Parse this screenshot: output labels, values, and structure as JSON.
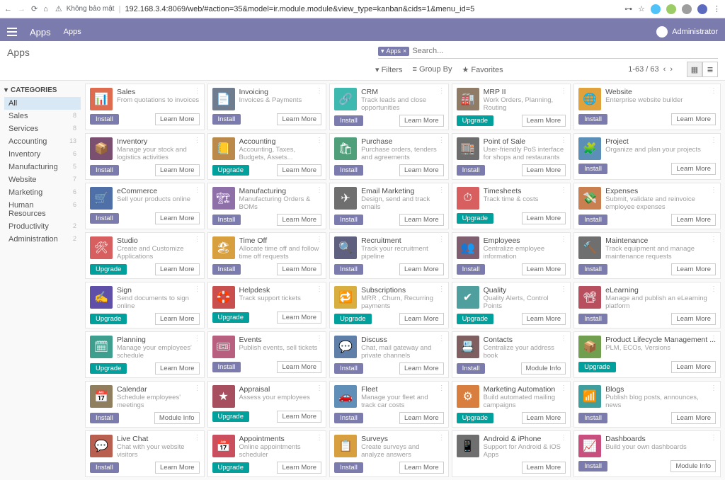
{
  "chrome": {
    "insecure": "Không bảo mật",
    "url": "192.168.3.4:8069/web/#action=35&model=ir.module.module&view_type=kanban&cids=1&menu_id=5"
  },
  "topbar": {
    "brand": "Apps",
    "menu": "Apps",
    "user": "Administrator"
  },
  "cp": {
    "title": "Apps",
    "facet_label": "Apps",
    "search_placeholder": "Search...",
    "filters": "Filters",
    "groupby": "Group By",
    "favorites": "Favorites",
    "pager": "1-63 / 63"
  },
  "sidebar": {
    "heading": "CATEGORIES",
    "items": [
      {
        "label": "All",
        "count": "",
        "active": true
      },
      {
        "label": "Sales",
        "count": "8"
      },
      {
        "label": "Services",
        "count": "8"
      },
      {
        "label": "Accounting",
        "count": "13"
      },
      {
        "label": "Inventory",
        "count": "6"
      },
      {
        "label": "Manufacturing",
        "count": "5"
      },
      {
        "label": "Website",
        "count": "7"
      },
      {
        "label": "Marketing",
        "count": "6"
      },
      {
        "label": "Human Resources",
        "count": "6"
      },
      {
        "label": "Productivity",
        "count": "2"
      },
      {
        "label": "Administration",
        "count": "2"
      }
    ]
  },
  "btn_labels": {
    "install": "Install",
    "upgrade": "Upgrade",
    "learn": "Learn More",
    "moduleinfo": "Module Info"
  },
  "apps": [
    {
      "name": "Sales",
      "desc": "From quotations to invoices",
      "color": "#e06c50",
      "btn": "install",
      "lm": "learn"
    },
    {
      "name": "Invoicing",
      "desc": "Invoices & Payments",
      "color": "#707d8f",
      "btn": "install",
      "lm": "learn"
    },
    {
      "name": "CRM",
      "desc": "Track leads and close opportunities",
      "color": "#3db9af",
      "btn": "install",
      "lm": "learn"
    },
    {
      "name": "MRP II",
      "desc": "Work Orders, Planning, Routing",
      "color": "#8f7b66",
      "btn": "upgrade",
      "lm": "learn"
    },
    {
      "name": "Website",
      "desc": "Enterprise website builder",
      "color": "#e2a23b",
      "btn": "install",
      "lm": "learn"
    },
    {
      "name": "Inventory",
      "desc": "Manage your stock and logistics activities",
      "color": "#7a4f6f",
      "btn": "install",
      "lm": "learn"
    },
    {
      "name": "Accounting",
      "desc": "Accounting, Taxes, Budgets, Assets...",
      "color": "#bb8a4a",
      "btn": "upgrade",
      "lm": "learn"
    },
    {
      "name": "Purchase",
      "desc": "Purchase orders, tenders and agreements",
      "color": "#4f9f7a",
      "btn": "install",
      "lm": "learn"
    },
    {
      "name": "Point of Sale",
      "desc": "User-friendly PoS interface for shops and restaurants",
      "color": "#6d6d6d",
      "btn": "install",
      "lm": "learn"
    },
    {
      "name": "Project",
      "desc": "Organize and plan your projects",
      "color": "#5c8fb8",
      "btn": "install",
      "lm": "learn"
    },
    {
      "name": "eCommerce",
      "desc": "Sell your products online",
      "color": "#4f6fa8",
      "btn": "install",
      "lm": "learn"
    },
    {
      "name": "Manufacturing",
      "desc": "Manufacturing Orders & BOMs",
      "color": "#8f6fa8",
      "btn": "install",
      "lm": "learn"
    },
    {
      "name": "Email Marketing",
      "desc": "Design, send and track emails",
      "color": "#6f6f6f",
      "btn": "install",
      "lm": "learn"
    },
    {
      "name": "Timesheets",
      "desc": "Track time & costs",
      "color": "#d85f5f",
      "btn": "upgrade",
      "lm": "learn"
    },
    {
      "name": "Expenses",
      "desc": "Submit, validate and reinvoice employee expenses",
      "color": "#c97f4f",
      "btn": "install",
      "lm": "learn"
    },
    {
      "name": "Studio",
      "desc": "Create and Customize Applications",
      "color": "#d85f5f",
      "btn": "upgrade",
      "lm": "learn"
    },
    {
      "name": "Time Off",
      "desc": "Allocate time off and follow time off requests",
      "color": "#d89f3f",
      "btn": "install",
      "lm": "learn"
    },
    {
      "name": "Recruitment",
      "desc": "Track your recruitment pipeline",
      "color": "#5f5f7f",
      "btn": "install",
      "lm": "learn"
    },
    {
      "name": "Employees",
      "desc": "Centralize employee information",
      "color": "#7f5f6f",
      "btn": "install",
      "lm": "learn"
    },
    {
      "name": "Maintenance",
      "desc": "Track equipment and manage maintenance requests",
      "color": "#6f6f6f",
      "btn": "install",
      "lm": "learn"
    },
    {
      "name": "Sign",
      "desc": "Send documents to sign online",
      "color": "#5f4fa8",
      "btn": "upgrade",
      "lm": "learn"
    },
    {
      "name": "Helpdesk",
      "desc": "Track support tickets",
      "color": "#c94f4f",
      "btn": "upgrade",
      "lm": "learn"
    },
    {
      "name": "Subscriptions",
      "desc": "MRR , Churn, Recurring payments",
      "color": "#d8af3f",
      "btn": "upgrade",
      "lm": "learn"
    },
    {
      "name": "Quality",
      "desc": "Quality Alerts, Control Points",
      "color": "#4f9f9f",
      "btn": "upgrade",
      "lm": "learn"
    },
    {
      "name": "eLearning",
      "desc": "Manage and publish an eLearning platform",
      "color": "#b84f5f",
      "btn": "install",
      "lm": "learn"
    },
    {
      "name": "Planning",
      "desc": "Manage your employees' schedule",
      "color": "#3f9f8f",
      "btn": "upgrade",
      "lm": "learn"
    },
    {
      "name": "Events",
      "desc": "Publish events, sell tickets",
      "color": "#b85f7f",
      "btn": "install",
      "lm": "learn"
    },
    {
      "name": "Discuss",
      "desc": "Chat, mail gateway and private channels",
      "color": "#5f7fa8",
      "btn": "install",
      "lm": "learn"
    },
    {
      "name": "Contacts",
      "desc": "Centralize your address book",
      "color": "#7f5f5f",
      "btn": "install",
      "lm": "moduleinfo"
    },
    {
      "name": "Product Lifecycle Management ...",
      "desc": "PLM, ECOs, Versions",
      "color": "#6f9f4f",
      "btn": "upgrade",
      "lm": "learn"
    },
    {
      "name": "Calendar",
      "desc": "Schedule employees' meetings",
      "color": "#8f7f5f",
      "btn": "install",
      "lm": "moduleinfo"
    },
    {
      "name": "Appraisal",
      "desc": "Assess your employees",
      "color": "#a84f5f",
      "btn": "upgrade",
      "lm": "learn"
    },
    {
      "name": "Fleet",
      "desc": "Manage your fleet and track car costs",
      "color": "#5f8fb8",
      "btn": "install",
      "lm": "learn"
    },
    {
      "name": "Marketing Automation",
      "desc": "Build automated mailing campaigns",
      "color": "#d87f3f",
      "btn": "upgrade",
      "lm": "learn"
    },
    {
      "name": "Blogs",
      "desc": "Publish blog posts, announces, news",
      "color": "#3f9f9f",
      "btn": "install",
      "lm": "learn"
    },
    {
      "name": "Live Chat",
      "desc": "Chat with your website visitors",
      "color": "#b85f4f",
      "btn": "install",
      "lm": "learn"
    },
    {
      "name": "Appointments",
      "desc": "Online appointments scheduler",
      "color": "#c94f5f",
      "btn": "upgrade",
      "lm": "learn"
    },
    {
      "name": "Surveys",
      "desc": "Create surveys and analyze answers",
      "color": "#d89f3f",
      "btn": "install",
      "lm": "learn"
    },
    {
      "name": "Android & iPhone",
      "desc": "Support for Android & iOS Apps",
      "color": "#6f6f6f",
      "btn": "none",
      "lm": "learn"
    },
    {
      "name": "Dashboards",
      "desc": "Build your own dashboards",
      "color": "#c94f7f",
      "btn": "install",
      "lm": "moduleinfo"
    }
  ],
  "icons": [
    "📊",
    "📄",
    "🔗",
    "🏭",
    "🌐",
    "📦",
    "📒",
    "🛍",
    "🏬",
    "🧩",
    "🛒",
    "🏗",
    "✈",
    "⏱",
    "💸",
    "🛠",
    "🏖",
    "🔍",
    "👥",
    "🔨",
    "✍",
    "🛟",
    "🔁",
    "✔",
    "📽",
    "🗓",
    "🎟",
    "💬",
    "📇",
    "📦",
    "📅",
    "★",
    "🚗",
    "⚙",
    "📶",
    "💬",
    "📅",
    "📋",
    "📱",
    "📈"
  ]
}
